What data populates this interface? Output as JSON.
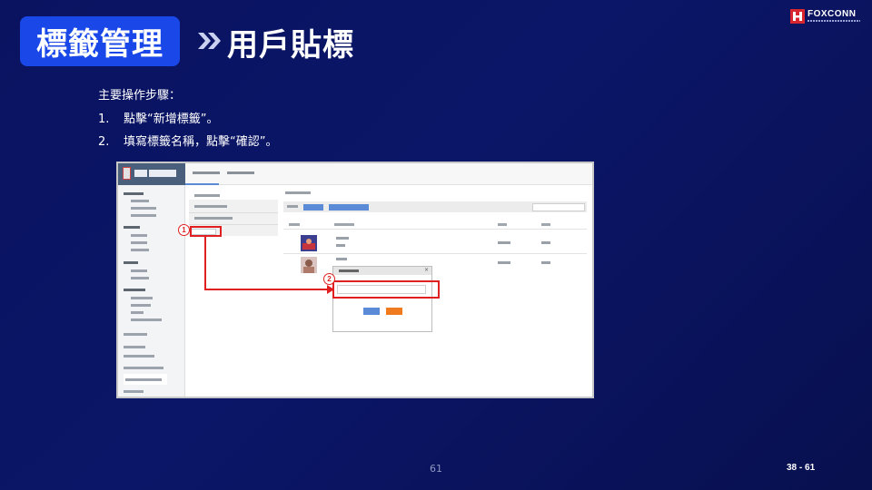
{
  "header": {
    "section_title": "標籤管理",
    "page_title": "用戶貼標",
    "logo_text": "FOXCONN"
  },
  "instructions": {
    "heading": "主要操作步驟：",
    "steps": [
      {
        "number": "1.",
        "text": "點擊“新增標籤”。"
      },
      {
        "number": "2.",
        "text": "填寫標籤名稱，點擊“確認”。"
      }
    ]
  },
  "screenshot": {
    "callouts": [
      "1",
      "2"
    ],
    "modal_close": "×"
  },
  "footer": {
    "page_number": "61",
    "page_range": "38 - 61"
  },
  "colors": {
    "background": "#0a1360",
    "title_box": "#1a48e8",
    "highlight": "#e02020",
    "primary_button": "#5b8ad6",
    "cancel_button": "#f07a1e"
  }
}
